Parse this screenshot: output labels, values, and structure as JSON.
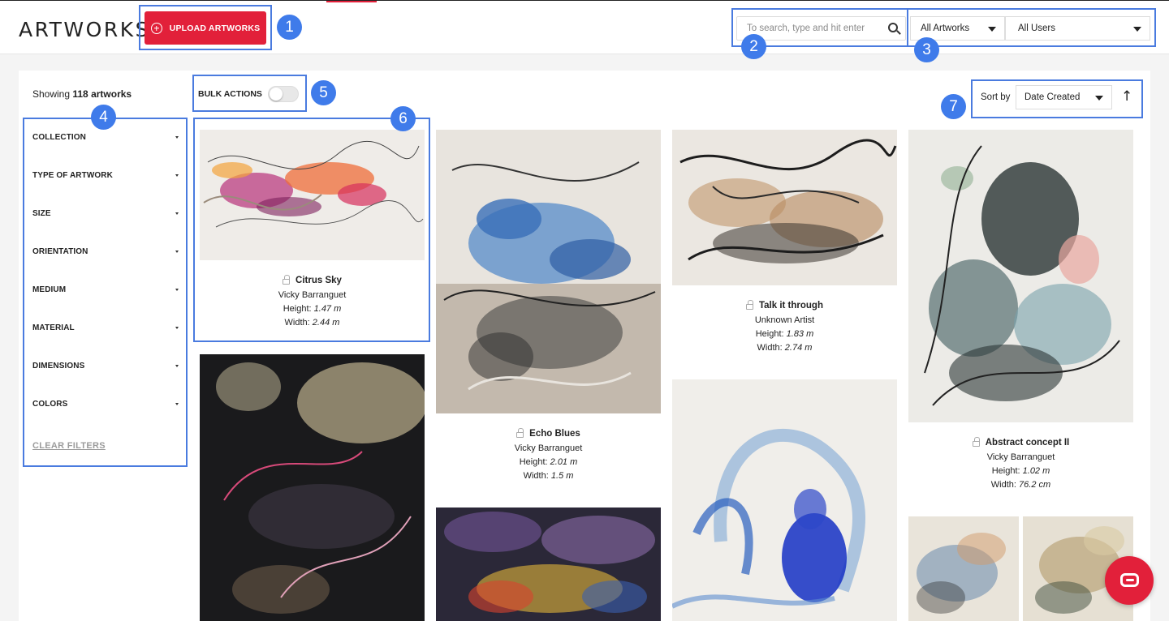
{
  "header": {
    "logo": "ARTWORKS",
    "upload_label": "UPLOAD ARTWORKS",
    "search_placeholder": "To search, type and hit enter",
    "artworks_filter": "All Artworks",
    "users_filter": "All Users"
  },
  "toolbar": {
    "showing_prefix": "Showing",
    "showing_count": "118 artworks",
    "bulk_actions_label": "BULK ACTIONS",
    "sort_label": "Sort by",
    "sort_value": "Date Created",
    "sort_direction_icon": "↑"
  },
  "filters": {
    "items": [
      {
        "label": "COLLECTION"
      },
      {
        "label": "TYPE OF ARTWORK"
      },
      {
        "label": "SIZE"
      },
      {
        "label": "ORIENTATION"
      },
      {
        "label": "MEDIUM"
      },
      {
        "label": "MATERIAL"
      },
      {
        "label": "DIMENSIONS"
      },
      {
        "label": "COLORS"
      }
    ],
    "clear_label": "CLEAR FILTERS"
  },
  "annotations": [
    "1",
    "2",
    "3",
    "4",
    "5",
    "6",
    "7"
  ],
  "artworks": [
    {
      "title": "Citrus Sky",
      "artist": "Vicky Barranguet",
      "height_label": "Height:",
      "height": "1.47 m",
      "width_label": "Width:",
      "width": "2.44 m"
    },
    {
      "title": "Echo Blues",
      "artist": "Vicky Barranguet",
      "height_label": "Height:",
      "height": "2.01 m",
      "width_label": "Width:",
      "width": "1.5 m"
    },
    {
      "title": "Talk it through",
      "artist": "Unknown Artist",
      "height_label": "Height:",
      "height": "1.83 m",
      "width_label": "Width:",
      "width": "2.74 m"
    },
    {
      "title": "Abstract concept II",
      "artist": "Vicky Barranguet",
      "height_label": "Height:",
      "height": "1.02 m",
      "width_label": "Width:",
      "width": "76.2 cm"
    }
  ],
  "colors": {
    "brand_red": "#e2203a",
    "annotation_blue": "#3f7bea"
  },
  "icons": {
    "upload": "plus-circle-icon",
    "search": "search-icon",
    "lock": "lock-icon",
    "chat": "chat-icon"
  }
}
